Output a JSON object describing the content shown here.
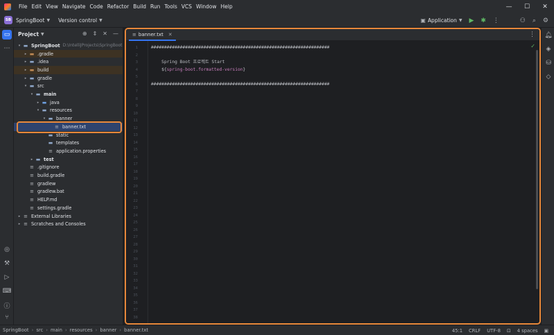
{
  "menubar": {
    "items": [
      "File",
      "Edit",
      "View",
      "Navigate",
      "Code",
      "Refactor",
      "Build",
      "Run",
      "Tools",
      "VCS",
      "Window",
      "Help"
    ],
    "minimize": "—",
    "maximize": "☐",
    "close": "✕"
  },
  "toolbar": {
    "project_badge": "SB",
    "project_name": "SpringBoot",
    "vcs_label": "Version control",
    "run_config": "Application"
  },
  "project_panel": {
    "title": "Project",
    "tree": [
      {
        "label": "SpringBoot",
        "hint": "D:\\IntelliJProjects\\SpringBoot",
        "depth": 0,
        "arrow": "▾",
        "icon": "folder",
        "style": "normal",
        "bold": true
      },
      {
        "label": ".gradle",
        "depth": 1,
        "arrow": "▸",
        "icon": "folder-orange",
        "style": "excluded"
      },
      {
        "label": ".idea",
        "depth": 1,
        "arrow": "▸",
        "icon": "folder",
        "style": "normal"
      },
      {
        "label": "build",
        "depth": 1,
        "arrow": "▸",
        "icon": "folder-orange",
        "style": "excluded"
      },
      {
        "label": "gradle",
        "depth": 1,
        "arrow": "▸",
        "icon": "folder",
        "style": "normal"
      },
      {
        "label": "src",
        "depth": 1,
        "arrow": "▾",
        "icon": "folder",
        "style": "normal"
      },
      {
        "label": "main",
        "depth": 2,
        "arrow": "▾",
        "icon": "folder",
        "style": "normal",
        "bold": true
      },
      {
        "label": "java",
        "depth": 3,
        "arrow": "▸",
        "icon": "folder-src",
        "style": "normal"
      },
      {
        "label": "resources",
        "depth": 3,
        "arrow": "▾",
        "icon": "folder",
        "style": "normal"
      },
      {
        "label": "banner",
        "depth": 4,
        "arrow": "▾",
        "icon": "folder",
        "style": "normal"
      },
      {
        "label": "banner.txt",
        "depth": 5,
        "arrow": "",
        "icon": "file",
        "style": "selected"
      },
      {
        "label": "static",
        "depth": 4,
        "arrow": "",
        "icon": "folder",
        "style": "normal"
      },
      {
        "label": "templates",
        "depth": 4,
        "arrow": "",
        "icon": "folder",
        "style": "normal"
      },
      {
        "label": "application.properties",
        "depth": 4,
        "arrow": "",
        "icon": "file",
        "style": "normal"
      },
      {
        "label": "test",
        "depth": 2,
        "arrow": "▸",
        "icon": "folder",
        "style": "normal",
        "bold": true
      },
      {
        "label": ".gitignore",
        "depth": 1,
        "arrow": "",
        "icon": "file",
        "style": "normal"
      },
      {
        "label": "build.gradle",
        "depth": 1,
        "arrow": "",
        "icon": "file",
        "style": "normal"
      },
      {
        "label": "gradlew",
        "depth": 1,
        "arrow": "",
        "icon": "file",
        "style": "normal"
      },
      {
        "label": "gradlew.bat",
        "depth": 1,
        "arrow": "",
        "icon": "file",
        "style": "normal"
      },
      {
        "label": "HELP.md",
        "depth": 1,
        "arrow": "",
        "icon": "file",
        "style": "normal"
      },
      {
        "label": "settings.gradle",
        "depth": 1,
        "arrow": "",
        "icon": "file",
        "style": "normal"
      },
      {
        "label": "External Libraries",
        "depth": 0,
        "arrow": "▸",
        "icon": "file",
        "style": "normal"
      },
      {
        "label": "Scratches and Consoles",
        "depth": 0,
        "arrow": "▸",
        "icon": "file",
        "style": "normal"
      }
    ]
  },
  "editor": {
    "tab_label": "banner.txt",
    "line_count": 38,
    "lines": [
      {
        "n": 1,
        "text": "####################################################################"
      },
      {
        "n": 2,
        "text": ""
      },
      {
        "n": 3,
        "text": "    Spring Boot 프로젝트 Start"
      },
      {
        "n": 4,
        "text": "    ${spring-boot.formatted-version}"
      },
      {
        "n": 5,
        "text": ""
      },
      {
        "n": 6,
        "text": "####################################################################"
      }
    ]
  },
  "statusbar": {
    "breadcrumbs": [
      "SpringBoot",
      "src",
      "main",
      "resources",
      "banner",
      "banner.txt"
    ],
    "position": "45:1",
    "line_sep": "CRLF",
    "encoding": "UTF-8",
    "indent": "4 spaces"
  },
  "colors": {
    "accent": "#3574f0",
    "highlight": "#e8883a",
    "bg": "#1e1f22",
    "panel": "#2b2d30"
  }
}
